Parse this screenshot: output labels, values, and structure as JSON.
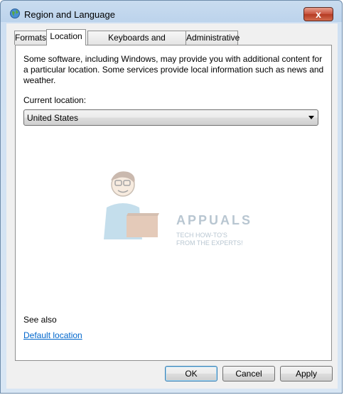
{
  "window": {
    "title": "Region and Language",
    "icon": "globe-icon",
    "close": "x"
  },
  "tabs": [
    {
      "label": "Formats",
      "active": false
    },
    {
      "label": "Location",
      "active": true
    },
    {
      "label": "Keyboards and Languages",
      "active": false
    },
    {
      "label": "Administrative",
      "active": false
    }
  ],
  "location": {
    "description": "Some software, including Windows, may provide you with additional content for a particular location. Some services provide local information such as news and weather.",
    "current_label": "Current location:",
    "current_value": "United States"
  },
  "watermark": {
    "brand": "APPUALS",
    "tagline": "TECH HOW-TO'S FROM THE EXPERTS!"
  },
  "see_also": {
    "label": "See also",
    "link": "Default location"
  },
  "buttons": {
    "ok": "OK",
    "cancel": "Cancel",
    "apply": "Apply"
  },
  "colors": {
    "link": "#0066cc",
    "close": "#c7503b"
  }
}
